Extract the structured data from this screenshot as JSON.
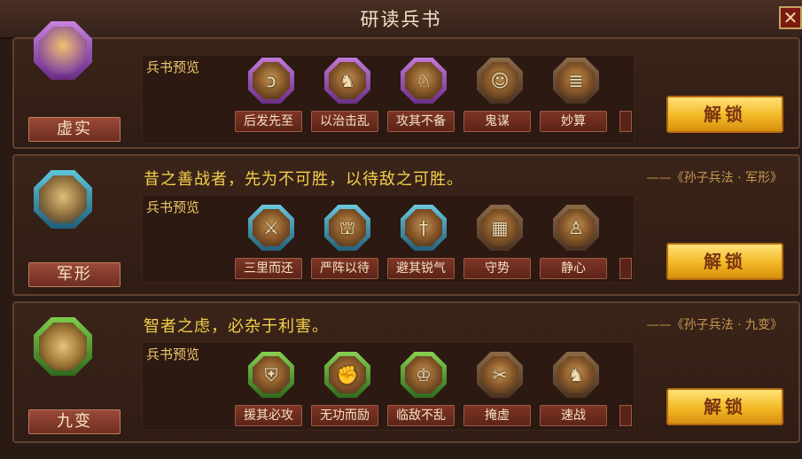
{
  "window": {
    "title": "研读兵书",
    "close_label": "✕"
  },
  "colors": {
    "purple_frame": "#8d4aa6",
    "teal_frame": "#2f8aa3",
    "green_frame": "#3f8a2c",
    "gold_button": "#f2b824",
    "quote_text": "#f2cf4a"
  },
  "books": [
    {
      "name": "虚实",
      "emblem_icon": "burst-emblem-icon",
      "quote": "",
      "source": "",
      "preview_label": "兵书预览",
      "unlock_label": "解锁",
      "skills": [
        {
          "name": "后发先至",
          "icon": "swirl-icon",
          "frame": "purple"
        },
        {
          "name": "以治击乱",
          "icon": "warrior-icon",
          "frame": "purple"
        },
        {
          "name": "攻其不备",
          "icon": "beast-icon",
          "frame": "purple"
        },
        {
          "name": "鬼谋",
          "icon": "strategist-icon",
          "frame": "brown"
        },
        {
          "name": "妙算",
          "icon": "scroll-icon",
          "frame": "brown"
        }
      ]
    },
    {
      "name": "军形",
      "emblem_icon": "shield-arrow-emblem-icon",
      "quote": "昔之善战者，先为不可胜，以待敌之可胜。",
      "source": "——《孙子兵法 · 军形》",
      "preview_label": "兵书预览",
      "unlock_label": "解锁",
      "skills": [
        {
          "name": "三里而还",
          "icon": "spear-icon",
          "frame": "teal"
        },
        {
          "name": "严阵以待",
          "icon": "formation-icon",
          "frame": "teal"
        },
        {
          "name": "避其锐气",
          "icon": "sword-icon",
          "frame": "teal"
        },
        {
          "name": "守势",
          "icon": "fortress-icon",
          "frame": "brown"
        },
        {
          "name": "静心",
          "icon": "meditation-icon",
          "frame": "brown"
        }
      ]
    },
    {
      "name": "九变",
      "emblem_icon": "yin-yang-emblem-icon",
      "quote": "智者之虑，必杂于利害。",
      "source": "——《孙子兵法 · 九变》",
      "preview_label": "兵书预览",
      "unlock_label": "解锁",
      "skills": [
        {
          "name": "援其必攻",
          "icon": "armor-icon",
          "frame": "green"
        },
        {
          "name": "无功而励",
          "icon": "raised-fist-icon",
          "frame": "green"
        },
        {
          "name": "临敌不乱",
          "icon": "general-icon",
          "frame": "green"
        },
        {
          "name": "掩虚",
          "icon": "blades-icon",
          "frame": "brown"
        },
        {
          "name": "速战",
          "icon": "charge-icon",
          "frame": "brown"
        }
      ]
    }
  ]
}
